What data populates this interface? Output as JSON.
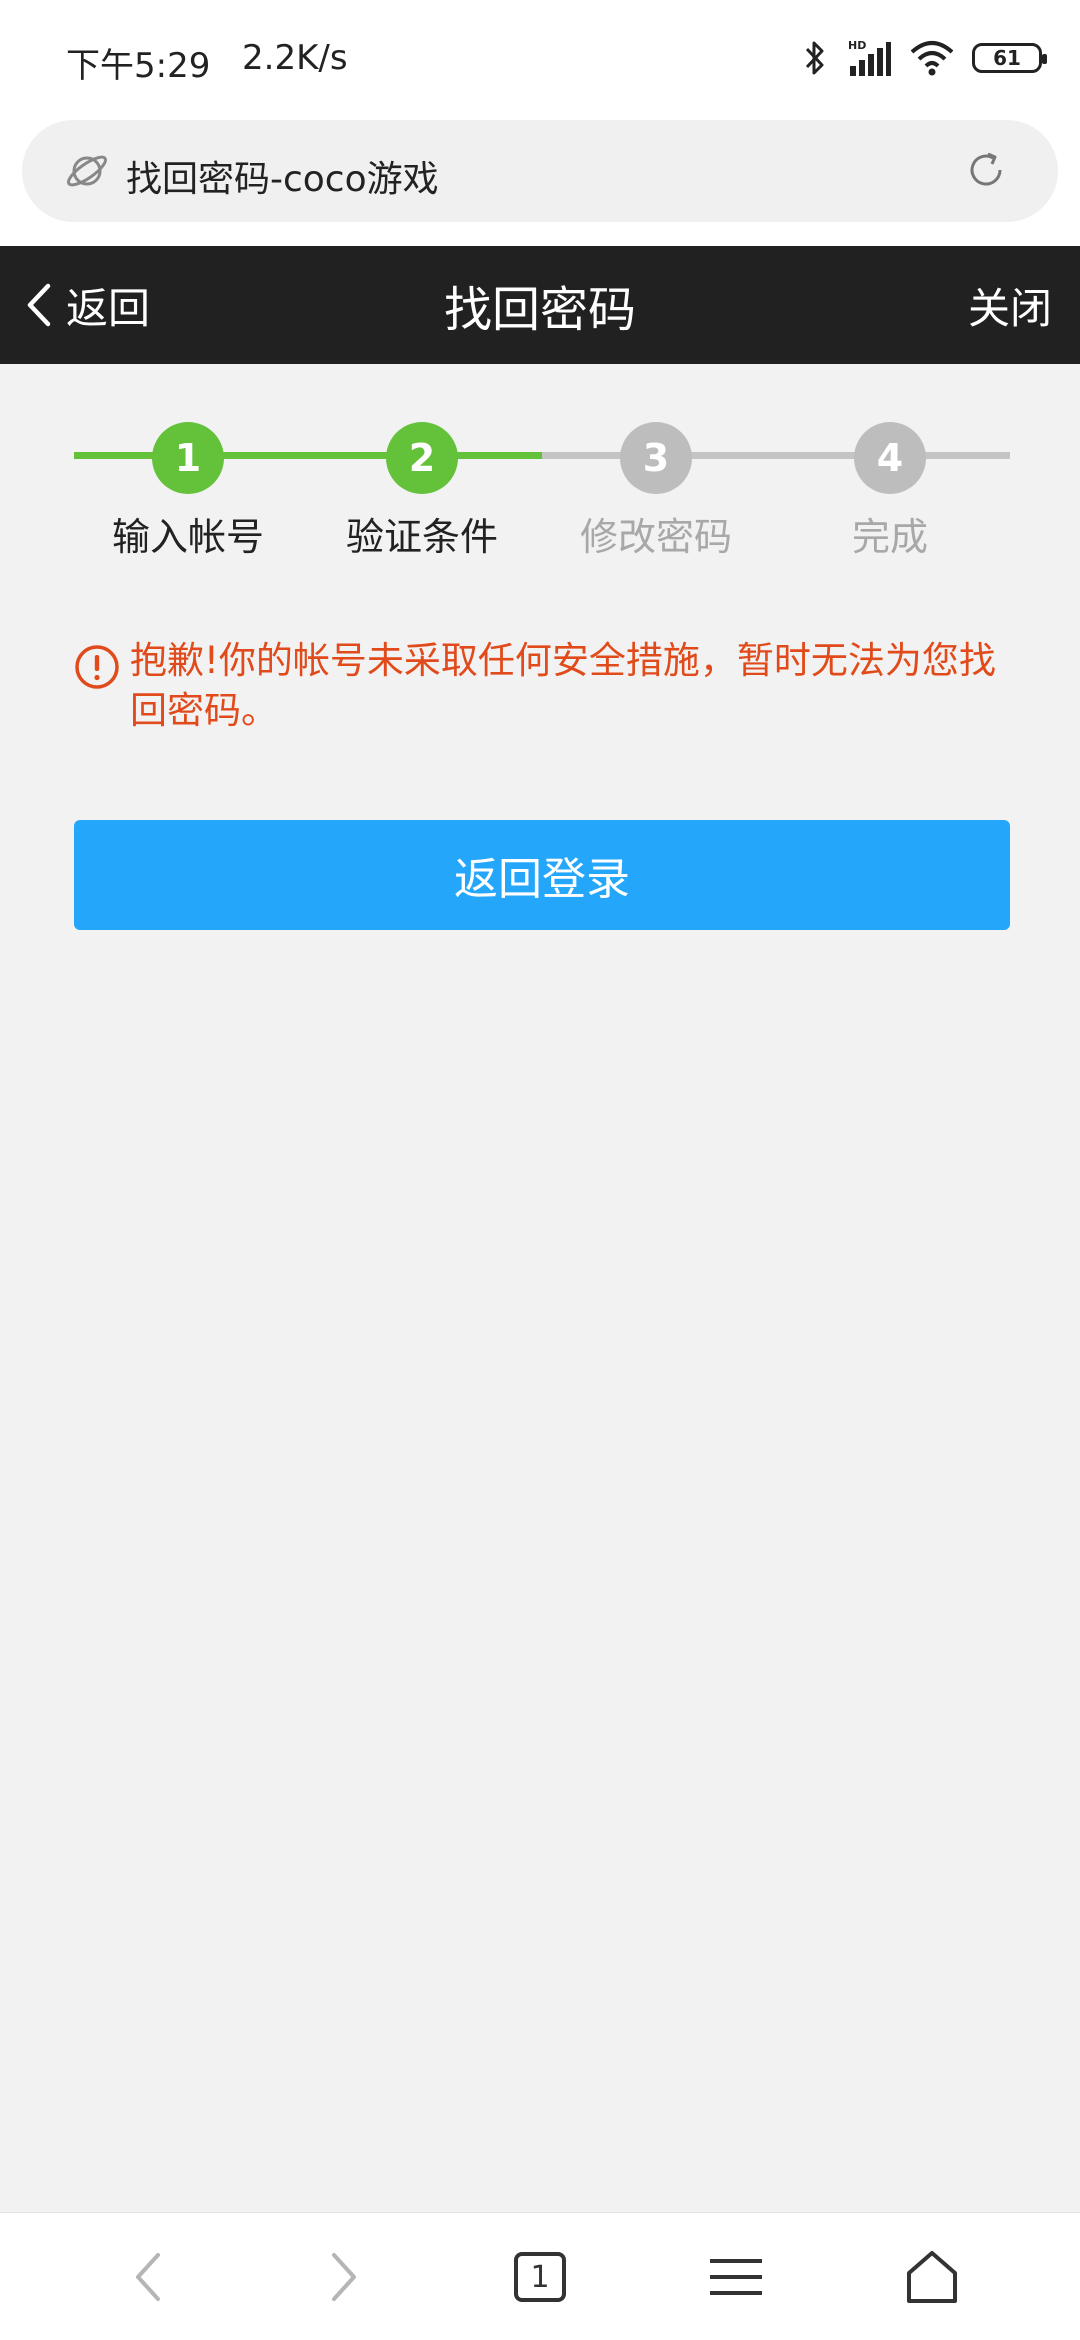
{
  "status_bar": {
    "time": "下午5:29",
    "net_speed": "2.2K/s",
    "battery": "61",
    "icons": [
      "bluetooth-icon",
      "hd-signal-icon",
      "wifi-icon",
      "battery-icon"
    ]
  },
  "address_bar": {
    "title": "找回密码-coco游戏",
    "icons": [
      "planet-icon",
      "reload-icon"
    ]
  },
  "header": {
    "back_label": "返回",
    "title": "找回密码",
    "close_label": "关闭"
  },
  "steps": [
    {
      "number": "1",
      "label": "输入帐号",
      "state": "done"
    },
    {
      "number": "2",
      "label": "验证条件",
      "state": "done"
    },
    {
      "number": "3",
      "label": "修改密码",
      "state": "todo"
    },
    {
      "number": "4",
      "label": "完成",
      "state": "todo"
    }
  ],
  "message": {
    "text": "抱歉!你的帐号未采取任何安全措施，暂时无法为您找回密码。",
    "color": "#e14b1c"
  },
  "login_button": {
    "label": "返回登录",
    "color": "#24a7fb"
  },
  "bottom_bar": {
    "tab_count": "1",
    "icons": [
      "back-arrow-icon",
      "forward-arrow-icon",
      "tabs-icon",
      "menu-icon",
      "home-icon"
    ]
  },
  "colors": {
    "step_done": "#63c13a",
    "step_todo": "#bdbdbd",
    "header_bg": "#212121"
  }
}
